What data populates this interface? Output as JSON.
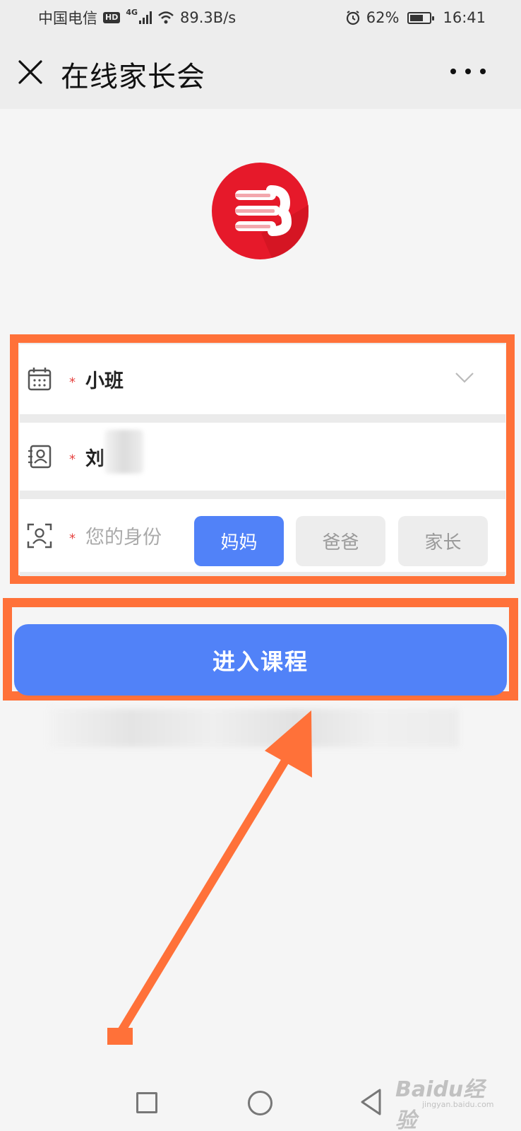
{
  "status_bar": {
    "carrier": "中国电信",
    "hd": "HD",
    "network": "4G",
    "speed": "89.3B/s",
    "battery": "62%",
    "time": "16:41"
  },
  "title_bar": {
    "title": "在线家长会",
    "close_icon": "close-icon",
    "more_icon": "more-icon"
  },
  "logo": {
    "icon": "brand-logo",
    "color": "#e6192a"
  },
  "form": {
    "class_field": {
      "icon": "calendar-icon",
      "required_mark": "*",
      "value": "小班",
      "dropdown_icon": "chevron-down-icon"
    },
    "name_field": {
      "icon": "contact-card-icon",
      "required_mark": "*",
      "value": "刘"
    },
    "role_field": {
      "icon": "user-scan-icon",
      "required_mark": "*",
      "label": "您的身份",
      "options": [
        "妈妈",
        "爸爸",
        "家长"
      ],
      "selected": "妈妈"
    }
  },
  "enter_button": {
    "label": "进入课程"
  },
  "colors": {
    "accent": "#5182f8",
    "annotation": "#ff7139",
    "required": "#e64340"
  },
  "watermark": {
    "text": "Baidu经验",
    "sub": "jingyan.baidu.com"
  }
}
